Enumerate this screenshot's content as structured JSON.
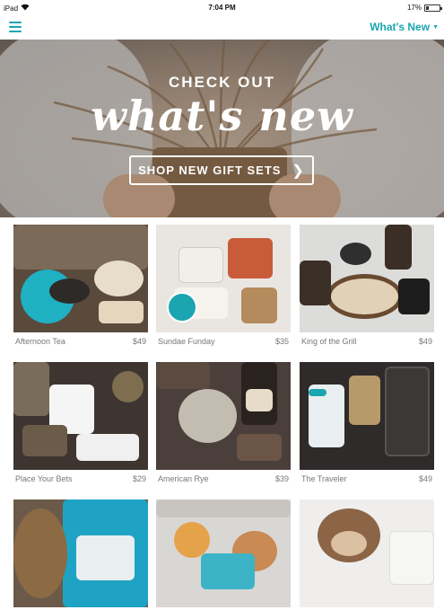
{
  "status_bar": {
    "device": "iPad",
    "time": "7:04 PM",
    "battery": "17%",
    "battery_level": 0.17
  },
  "nav": {
    "dropdown_label": "What's New"
  },
  "hero": {
    "eyebrow": "CHECK OUT",
    "title": "what's new",
    "cta_label": "SHOP NEW GIFT SETS"
  },
  "products": [
    {
      "name": "Afternoon Tea",
      "price": "$49"
    },
    {
      "name": "Sundae Funday",
      "price": "$35"
    },
    {
      "name": "King of the Grill",
      "price": "$49"
    },
    {
      "name": "Place Your Bets",
      "price": "$29"
    },
    {
      "name": "American Rye",
      "price": "$39"
    },
    {
      "name": "The Traveler",
      "price": "$49"
    },
    {
      "name": "",
      "price": ""
    },
    {
      "name": "",
      "price": ""
    },
    {
      "name": "",
      "price": ""
    }
  ],
  "product_badges": {
    "sundae_badge": ""
  },
  "colors": {
    "accent": "#1aa5b0"
  }
}
